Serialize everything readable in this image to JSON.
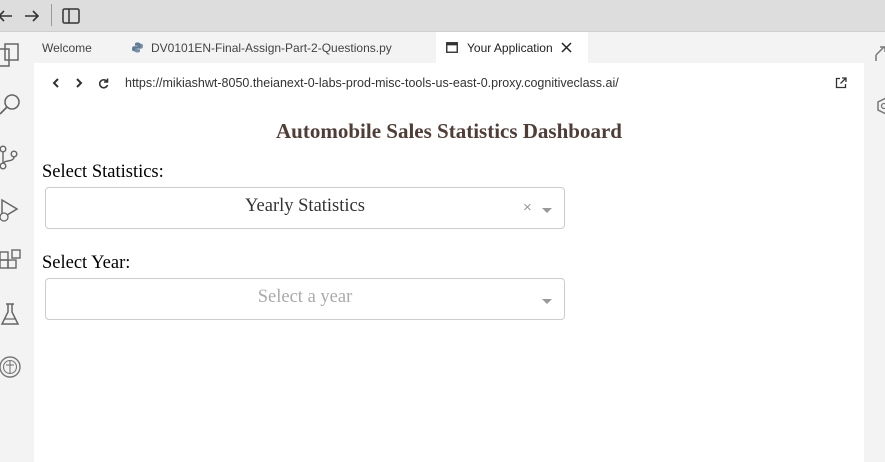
{
  "titlebar": {
    "back_icon": "arrow-left-icon",
    "forward_icon": "arrow-right-icon",
    "layout_icon": "split-panel-icon"
  },
  "activitybar": {
    "icons": [
      "explorer-icon",
      "search-icon",
      "source-control-icon",
      "run-debug-icon",
      "extensions-icon",
      "flask-icon",
      "skills-network-icon"
    ]
  },
  "tabs": [
    {
      "label": "Welcome"
    },
    {
      "label": "DV0101EN-Final-Assign-Part-2-Questions.py",
      "icon": "python-icon"
    },
    {
      "label": "Your Application",
      "icon": "browser-icon",
      "close_icon": "close-icon"
    }
  ],
  "browser": {
    "url": "https://mikiashwt-8050.theianext-0-labs-prod-misc-tools-us-east-0.proxy.cognitiveclass.ai/",
    "open_external_icon": "open-external-icon"
  },
  "dashboard": {
    "title": "Automobile Sales Statistics Dashboard",
    "stats_label": "Select Statistics:",
    "stats_value": "Yearly Statistics",
    "clear_symbol": "×",
    "year_label": "Select Year:",
    "year_placeholder": "Select a year"
  },
  "colors": {
    "title_color": "#503d36",
    "chrome_bg": "#dddddd",
    "sidebar_bg": "#f3f3f3"
  }
}
